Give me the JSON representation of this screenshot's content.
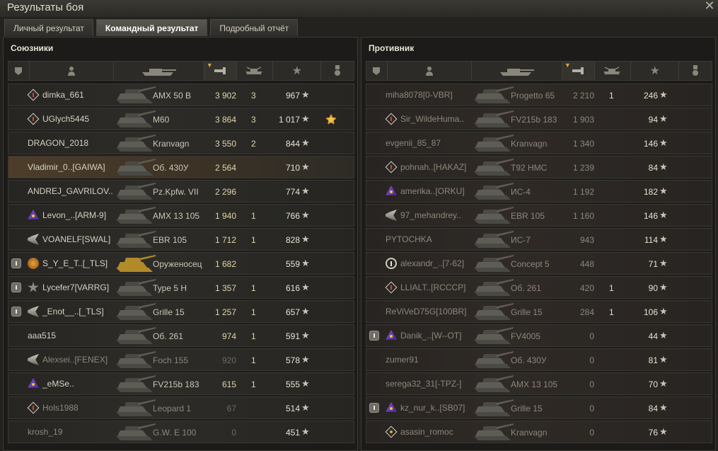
{
  "window": {
    "title": "Результаты боя"
  },
  "tabs": [
    {
      "label": "Личный результат",
      "active": false
    },
    {
      "label": "Командный результат",
      "active": true
    },
    {
      "label": "Подробный отчёт",
      "active": false
    }
  ],
  "allies": {
    "title": "Союзники",
    "rows": [
      {
        "player": "dimka_661",
        "tank": "AMX 50 B",
        "damage": "3 902",
        "frags": "3",
        "xp": "967",
        "rank": "diamond",
        "platoon": false,
        "medal": false,
        "highlight": false,
        "dead": false,
        "golden": false
      },
      {
        "player": "UGlych5445",
        "tank": "M60",
        "damage": "3 864",
        "frags": "3",
        "xp": "1 017",
        "rank": "diamond",
        "platoon": false,
        "medal": true,
        "highlight": false,
        "dead": false,
        "golden": false
      },
      {
        "player": "DRAGON_2018",
        "tank": "Kranvagn",
        "damage": "3 550",
        "frags": "2",
        "xp": "844",
        "rank": "",
        "platoon": false,
        "medal": false,
        "highlight": false,
        "dead": false,
        "golden": false
      },
      {
        "player": "Vladimir_0..[GAIWA]",
        "tank": "Об. 430У",
        "damage": "2 564",
        "frags": "",
        "xp": "710",
        "rank": "",
        "platoon": false,
        "medal": false,
        "highlight": true,
        "dead": false,
        "golden": false
      },
      {
        "player": "ANDREJ_GAVRILOV..",
        "tank": "Pz.Kpfw. VII",
        "damage": "2 296",
        "frags": "",
        "xp": "774",
        "rank": "",
        "platoon": false,
        "medal": false,
        "highlight": false,
        "dead": false,
        "golden": false
      },
      {
        "player": "Levon_..[ARM-9]",
        "tank": "AMX 13 105",
        "damage": "1 940",
        "frags": "1",
        "xp": "766",
        "rank": "purple",
        "platoon": false,
        "medal": false,
        "highlight": false,
        "dead": false,
        "golden": false
      },
      {
        "player": "VOANELF[SWAL]",
        "tank": "EBR 105",
        "damage": "1 712",
        "frags": "1",
        "xp": "828",
        "rank": "wing",
        "platoon": false,
        "medal": false,
        "highlight": false,
        "dead": false,
        "golden": false
      },
      {
        "player": "S_Y_E_T..[_TLS]",
        "tank": "Оруженосец",
        "damage": "1 682",
        "frags": "",
        "xp": "559",
        "rank": "gold",
        "platoon": true,
        "medal": false,
        "highlight": false,
        "dead": false,
        "golden": true
      },
      {
        "player": "Lycefer7[VARRG]",
        "tank": "Type 5 H",
        "damage": "1 357",
        "frags": "1",
        "xp": "616",
        "rank": "star",
        "platoon": true,
        "medal": false,
        "highlight": false,
        "dead": false,
        "golden": false
      },
      {
        "player": "_Enot__..[_TLS]",
        "tank": "Grille 15",
        "damage": "1 257",
        "frags": "1",
        "xp": "657",
        "rank": "wing",
        "platoon": true,
        "medal": false,
        "highlight": false,
        "dead": false,
        "golden": false
      },
      {
        "player": "aaa515",
        "tank": "Об. 261",
        "damage": "974",
        "frags": "1",
        "xp": "591",
        "rank": "",
        "platoon": false,
        "medal": false,
        "highlight": false,
        "dead": false,
        "golden": false
      },
      {
        "player": "Alexsei..[FENEX]",
        "tank": "Foch 155",
        "damage": "920",
        "frags": "1",
        "xp": "578",
        "rank": "wing",
        "platoon": false,
        "medal": false,
        "highlight": false,
        "dead": true,
        "golden": false
      },
      {
        "player": "_eMSe..",
        "tank": "FV215b 183",
        "damage": "615",
        "frags": "1",
        "xp": "555",
        "rank": "purple",
        "platoon": false,
        "medal": false,
        "highlight": false,
        "dead": false,
        "golden": false
      },
      {
        "player": "Hols1988",
        "tank": "Leopard 1",
        "damage": "67",
        "frags": "",
        "xp": "514",
        "rank": "diamond",
        "platoon": false,
        "medal": false,
        "highlight": false,
        "dead": true,
        "golden": false
      },
      {
        "player": "krosh_19",
        "tank": "G.W. E 100",
        "damage": "0",
        "frags": "",
        "xp": "451",
        "rank": "",
        "platoon": false,
        "medal": false,
        "highlight": false,
        "dead": true,
        "golden": false
      }
    ]
  },
  "enemies": {
    "title": "Противник",
    "rows": [
      {
        "player": "miha8078[0-VBR]",
        "tank": "Progetto 65",
        "damage": "2 210",
        "frags": "1",
        "xp": "246",
        "rank": "",
        "platoon": false,
        "dead": true
      },
      {
        "player": "Sir_WildeHuma..",
        "tank": "FV215b 183",
        "damage": "1 903",
        "frags": "",
        "xp": "94",
        "rank": "diamond",
        "platoon": false,
        "dead": true
      },
      {
        "player": "evgenii_85_87",
        "tank": "Kranvagn",
        "damage": "1 340",
        "frags": "",
        "xp": "146",
        "rank": "",
        "platoon": false,
        "dead": true
      },
      {
        "player": "pohnah..[HAKAZ]",
        "tank": "T92 HMC",
        "damage": "1 239",
        "frags": "",
        "xp": "84",
        "rank": "diamond",
        "platoon": false,
        "dead": true
      },
      {
        "player": "amerika..[ORKU]",
        "tank": "ИС-4",
        "damage": "1 192",
        "frags": "",
        "xp": "182",
        "rank": "purple",
        "platoon": false,
        "dead": true
      },
      {
        "player": "97_mehandrey..",
        "tank": "EBR 105",
        "damage": "1 160",
        "frags": "",
        "xp": "146",
        "rank": "wing",
        "platoon": false,
        "dead": true
      },
      {
        "player": "PYTOCHKA",
        "tank": "ИС-7",
        "damage": "943",
        "frags": "",
        "xp": "114",
        "rank": "",
        "platoon": false,
        "dead": true
      },
      {
        "player": "alexandr_..[7-62]",
        "tank": "Concept 5",
        "damage": "448",
        "frags": "",
        "xp": "71",
        "rank": "circle",
        "platoon": false,
        "dead": true
      },
      {
        "player": "LLIALT..[RCCCP]",
        "tank": "Об. 261",
        "damage": "420",
        "frags": "1",
        "xp": "90",
        "rank": "diamond",
        "platoon": false,
        "dead": true
      },
      {
        "player": "ReViVeD75G[100BR]",
        "tank": "Grille 15",
        "damage": "284",
        "frags": "1",
        "xp": "106",
        "rank": "",
        "platoon": false,
        "dead": true
      },
      {
        "player": "Danik_..[W--OT]",
        "tank": "FV4005",
        "damage": "0",
        "frags": "",
        "xp": "44",
        "rank": "purple",
        "platoon": true,
        "dead": true
      },
      {
        "player": "zumer91",
        "tank": "Об. 430У",
        "damage": "0",
        "frags": "",
        "xp": "81",
        "rank": "",
        "platoon": false,
        "dead": true
      },
      {
        "player": "serega32_31[-TPZ-]",
        "tank": "AMX 13 105",
        "damage": "0",
        "frags": "",
        "xp": "70",
        "rank": "",
        "platoon": false,
        "dead": true
      },
      {
        "player": "kz_nur_k..[SB07]",
        "tank": "Grille 15",
        "damage": "0",
        "frags": "",
        "xp": "84",
        "rank": "purple",
        "platoon": true,
        "dead": true
      },
      {
        "player": "asasin_romoc",
        "tank": "Kranvagn",
        "damage": "0",
        "frags": "",
        "xp": "76",
        "rank": "diamond2",
        "platoon": false,
        "dead": true
      }
    ]
  },
  "columns": {
    "icons": [
      "platoon-icon",
      "player-icon",
      "tank-icon",
      "damage-icon",
      "frags-icon",
      "xp-star-icon",
      "medal-icon"
    ],
    "xp_glyph": "★"
  },
  "colors": {
    "accent_sort": "#d7a44a",
    "highlight_row": "#4d3d2a",
    "damage_text": "#e0d5a8"
  }
}
